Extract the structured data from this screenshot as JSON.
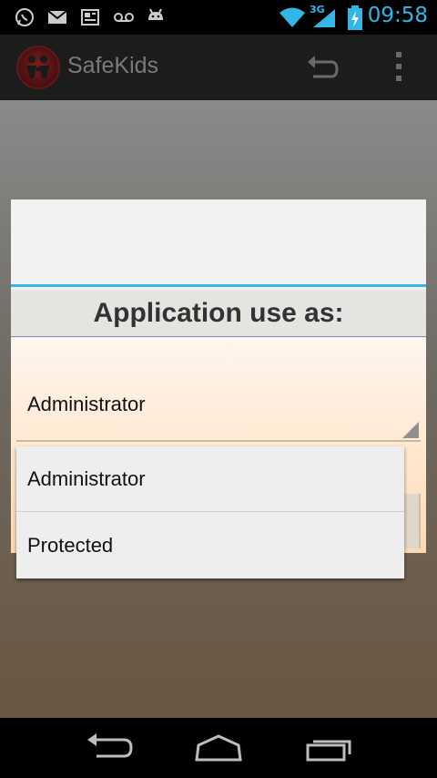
{
  "status_bar": {
    "time": "09:58",
    "network_type": "3G",
    "icons": [
      "whatsapp-icon",
      "mail-icon",
      "news-icon",
      "voicemail-icon",
      "android-icon",
      "wifi-icon",
      "signal-icon",
      "battery-charging-icon"
    ]
  },
  "action_bar": {
    "title": "SafeKids"
  },
  "dialog": {
    "heading": "Application use as:",
    "spinner_selected": "Administrator"
  },
  "dropdown": {
    "options": [
      "Administrator",
      "Protected"
    ]
  },
  "colors": {
    "accent": "#33b5e5",
    "status_time": "#33b5e5",
    "dialog_body_gradient_end": "#fcd9b5"
  }
}
